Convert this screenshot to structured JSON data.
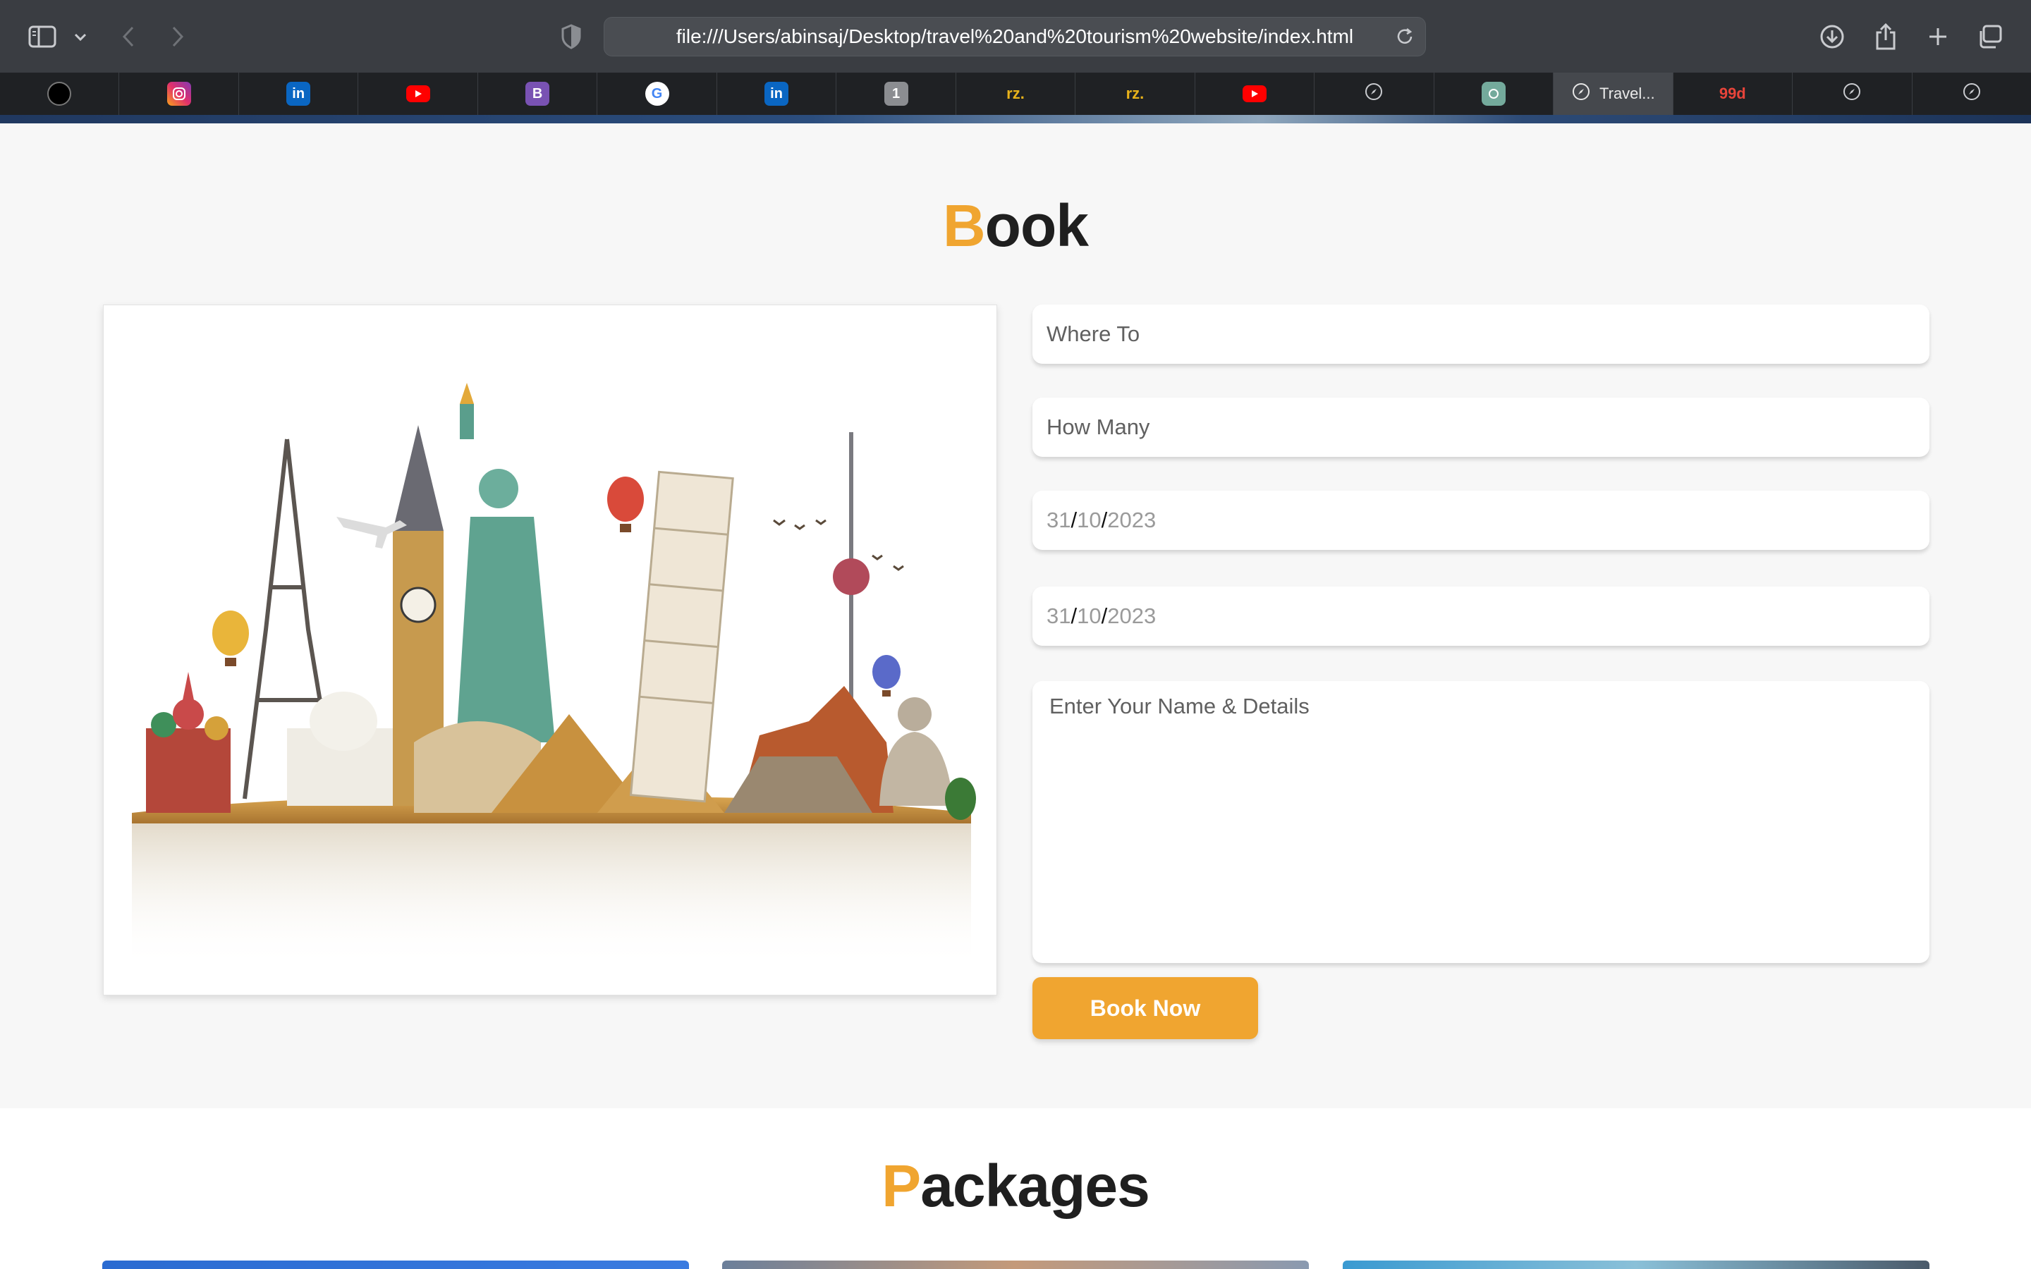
{
  "browser": {
    "url": "file:///Users/abinsaj/Desktop/travel%20and%20tourism%20website/index.html",
    "tabs": [
      {
        "icon": "black-circle-logo-icon",
        "label": ""
      },
      {
        "icon": "instagram-icon",
        "label": ""
      },
      {
        "icon": "linkedin-icon",
        "label": "in"
      },
      {
        "icon": "youtube-icon",
        "label": ""
      },
      {
        "icon": "bootstrap-icon",
        "label": "B"
      },
      {
        "icon": "google-icon",
        "label": "G"
      },
      {
        "icon": "linkedin-icon",
        "label": "in"
      },
      {
        "icon": "number-one-icon",
        "label": "1"
      },
      {
        "icon": "text-favicon",
        "label": "rz."
      },
      {
        "icon": "text-favicon",
        "label": "rz."
      },
      {
        "icon": "youtube-icon",
        "label": ""
      },
      {
        "icon": "compass-icon",
        "label": ""
      },
      {
        "icon": "chatgpt-icon",
        "label": ""
      },
      {
        "icon": "compass-icon",
        "label": "Travel..."
      },
      {
        "icon": "text-favicon",
        "label": "99d"
      },
      {
        "icon": "compass-icon",
        "label": ""
      },
      {
        "icon": "compass-icon",
        "label": ""
      }
    ],
    "active_tab": 13
  },
  "book": {
    "title_accent": "B",
    "title_rest": "ook",
    "where_placeholder": "Where To",
    "how_many_placeholder": "How Many",
    "arrival_date": {
      "day": "31",
      "month": "10",
      "year": "2023"
    },
    "leaving_date": {
      "day": "31",
      "month": "10",
      "year": "2023"
    },
    "details_placeholder": "Enter Your Name & Details",
    "submit_label": "Book Now"
  },
  "packages": {
    "title_accent": "P",
    "title_rest": "ackages"
  },
  "colors": {
    "accent": "#f0a530",
    "page_bg": "#f7f7f7",
    "heading": "#1f1f1f"
  }
}
